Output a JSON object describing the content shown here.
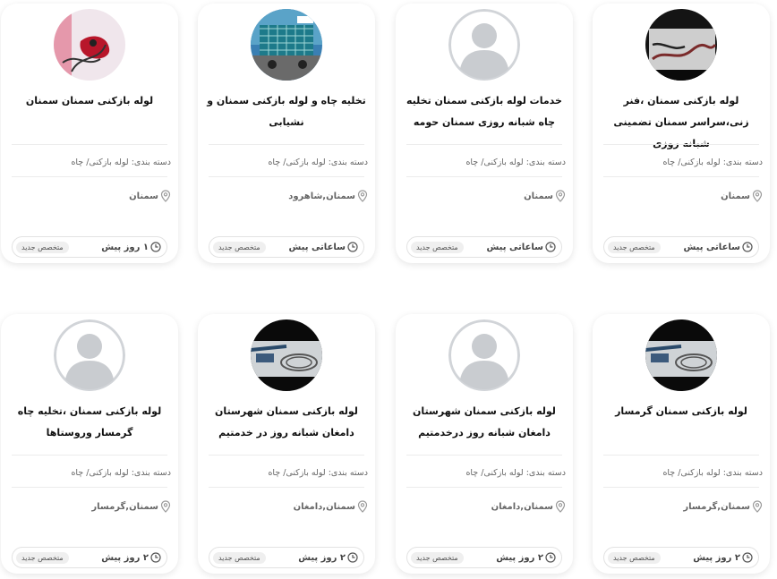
{
  "common": {
    "category_prefix": "دسته بندی:",
    "badge": "متخصص جدید"
  },
  "cards": [
    {
      "title": "لوله بازکنی سمنان ،فنر زنی،سراسر سمنان تضمینی شبانه روزی",
      "category": "لوله بازکنی/ چاه",
      "location": "سمنان",
      "time": "ساعاتی پیش",
      "avatar": "photo-spring-machine"
    },
    {
      "title": "خدمات لوله بازکنی سمنان تخلیه چاه شبانه روزی سمنان حومه",
      "category": "لوله بازکنی/ چاه",
      "location": "سمنان",
      "time": "ساعاتی پیش",
      "avatar": "default-user"
    },
    {
      "title": "تخلیه چاه و لوله بازکنی سمنان و نشیابی",
      "category": "لوله بازکنی/ چاه",
      "location": "سمنان,شاهرود",
      "time": "ساعاتی پیش",
      "avatar": "photo-truck"
    },
    {
      "title": "لوله بازکنی سمنان سمنان",
      "category": "لوله بازکنی/ چاه",
      "location": "سمنان",
      "time": "۱ روز پیش",
      "avatar": "photo-red-machine"
    },
    {
      "title": "لوله بازکنی سمنان گرمسار",
      "category": "لوله بازکنی/ چاه",
      "location": "سمنان,گرمسار",
      "time": "۲ روز پیش",
      "avatar": "photo-pipe-equipment"
    },
    {
      "title": "لوله بازکنی سمنان شهرستان دامغان شبانه روز درخدمتیم",
      "category": "لوله بازکنی/ چاه",
      "location": "سمنان,دامغان",
      "time": "۲ روز پیش",
      "avatar": "default-user"
    },
    {
      "title": "لوله بازکنی سمنان شهرستان دامغان شبانه روز در خدمتیم",
      "category": "لوله بازکنی/ چاه",
      "location": "سمنان,دامغان",
      "time": "۲ روز پیش",
      "avatar": "photo-pipe-equipment"
    },
    {
      "title": "لوله بازکنی سمنان ،تخلیه چاه گرمسار وروستاها",
      "category": "لوله بازکنی/ چاه",
      "location": "سمنان,گرمسار",
      "time": "۲ روز پیش",
      "avatar": "default-user"
    }
  ]
}
